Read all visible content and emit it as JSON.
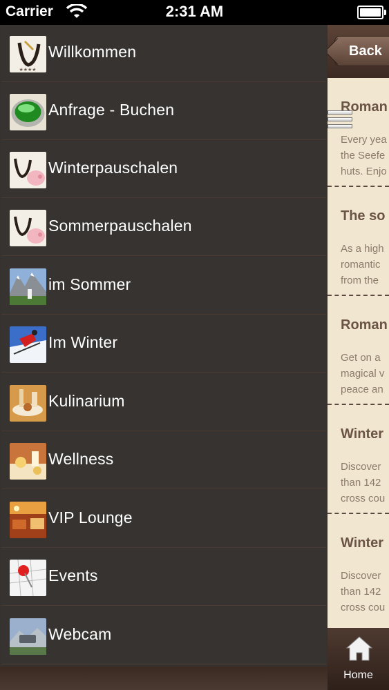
{
  "status_bar": {
    "carrier": "Carrier",
    "time": "2:31 AM"
  },
  "menu": {
    "items": [
      {
        "label": "Willkommen",
        "icon": "hotel-logo-icon"
      },
      {
        "label": "Anfrage - Buchen",
        "icon": "green-button-icon"
      },
      {
        "label": "Winterpauschalen",
        "icon": "hotel-logo-pig-icon"
      },
      {
        "label": "Sommerpauschalen",
        "icon": "hotel-logo-pig-icon"
      },
      {
        "label": "im Sommer",
        "icon": "mountain-church-photo-icon"
      },
      {
        "label": "Im Winter",
        "icon": "skier-photo-icon"
      },
      {
        "label": "Kulinarium",
        "icon": "food-photo-icon"
      },
      {
        "label": "Wellness",
        "icon": "wellness-photo-icon"
      },
      {
        "label": "VIP Lounge",
        "icon": "lounge-photo-icon"
      },
      {
        "label": "Events",
        "icon": "calendar-pin-icon"
      },
      {
        "label": "Webcam",
        "icon": "webcam-photo-icon"
      }
    ]
  },
  "content": {
    "back_label": "Back",
    "articles": [
      {
        "title": "Roman",
        "lines": [
          "Every yea",
          "the Seefe",
          "huts. Enjo"
        ]
      },
      {
        "title": "The so",
        "lines": [
          "As a high",
          "romantic",
          "from the"
        ]
      },
      {
        "title": "Roman",
        "lines": [
          "Get on a",
          "magical v",
          "peace an"
        ]
      },
      {
        "title": "Winter",
        "lines": [
          "Discover",
          "than 142",
          "cross cou"
        ]
      },
      {
        "title": "Winter",
        "lines": [
          "Discover",
          "than 142",
          "cross cou"
        ]
      }
    ],
    "tabbar": {
      "home_label": "Home"
    }
  }
}
